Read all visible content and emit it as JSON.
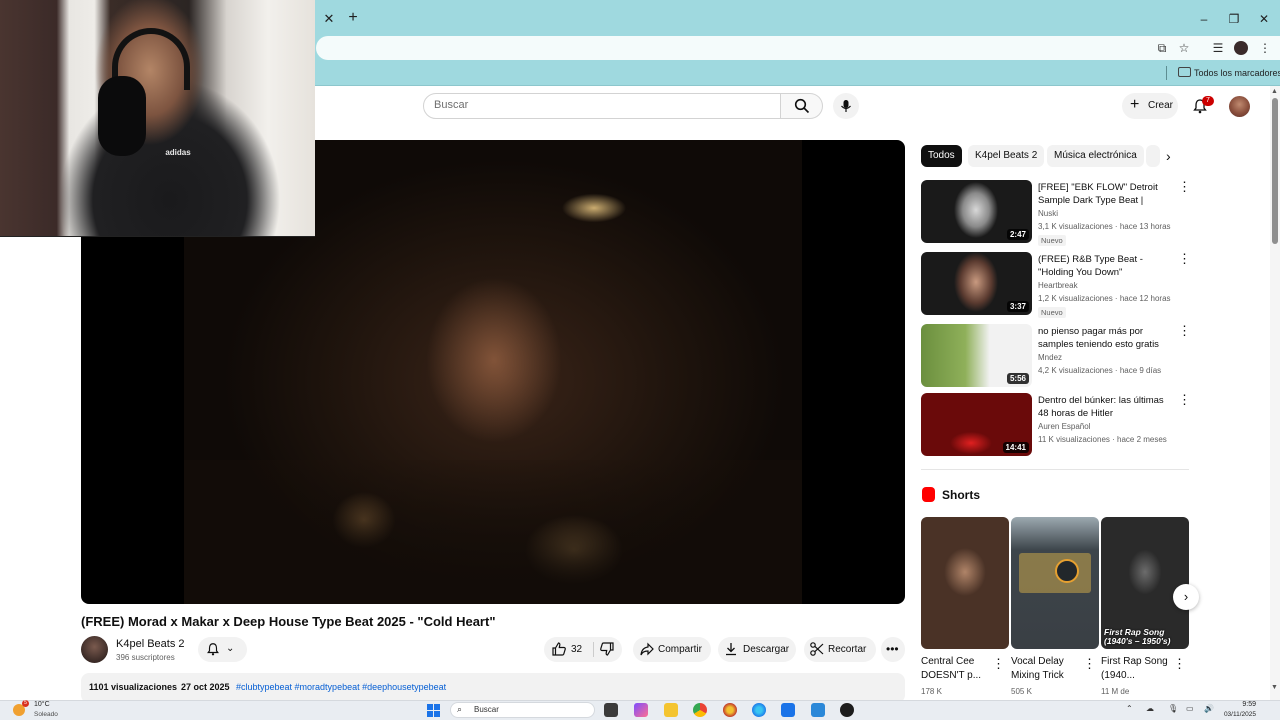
{
  "browser": {
    "bookmarks_folder": "Todos los marcadores"
  },
  "youtube": {
    "search_placeholder": "Buscar",
    "create_label": "Crear",
    "notifications_count": "7"
  },
  "video": {
    "title": "(FREE) Morad x Makar x Deep House Type Beat 2025 - \"Cold Heart\"",
    "channel_name": "K4pel Beats 2",
    "subscribers": "396 suscriptores",
    "likes": "32",
    "share_label": "Compartir",
    "download_label": "Descargar",
    "clip_label": "Recortar",
    "views": "1101 visualizaciones",
    "date": "27 oct 2025",
    "hashtags": "#clubtypebeat #moradtypebeat #deephousetypebeat",
    "webcam_logo": "adidas"
  },
  "chips": [
    "Todos",
    "K4pel Beats 2",
    "Música electrónica"
  ],
  "recommendations": [
    {
      "title": "[FREE] \"EBK FLOW\" Detroit Sample Dark Type Beat | Hade...",
      "channel": "Nuski",
      "meta": "3,1 K visualizaciones · hace 13 horas",
      "duration": "2:47",
      "badge": "Nuevo"
    },
    {
      "title": "(FREE) R&B Type Beat - \"Holding You Down\"",
      "channel": "Heartbreak",
      "meta": "1,2 K visualizaciones · hace 12 horas",
      "duration": "3:37",
      "badge": "Nuevo"
    },
    {
      "title": "no pienso pagar más por samples teniendo esto gratis",
      "channel": "Mndez",
      "meta": "4,2 K visualizaciones · hace 9 días",
      "duration": "5:56",
      "badge": ""
    },
    {
      "title": "Dentro del búnker: las últimas 48 horas de Hitler",
      "channel": "Auren Español",
      "meta": "11 K visualizaciones · hace 2 meses",
      "duration": "14:41",
      "badge": ""
    }
  ],
  "shorts": {
    "heading": "Shorts",
    "items": [
      {
        "title": "Central Cee DOESN'T p...",
        "views": "178 K",
        "overlay": ""
      },
      {
        "title": "Vocal Delay Mixing Trick",
        "views": "505 K",
        "overlay": ""
      },
      {
        "title": "First Rap Song (1940...",
        "views": "11 M de",
        "overlay": "First Rap Song (1940's – 1950's)"
      }
    ]
  },
  "taskbar": {
    "weather_temp": "10°C",
    "weather_desc": "Soleado",
    "weather_badge": "5",
    "search_label": "Buscar",
    "time": "9:59",
    "date": "03/11/2025"
  },
  "colors": {
    "chrome_theme": "#9fd9df",
    "youtube_red": "#ff0000",
    "link_blue": "#065fd4",
    "chip_active": "#0f0f0f"
  }
}
